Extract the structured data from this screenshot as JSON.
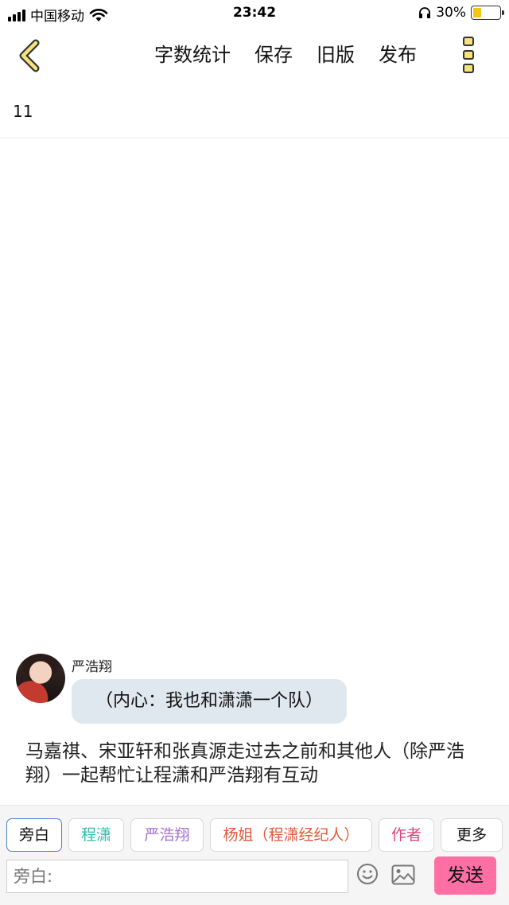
{
  "status_bar": {
    "carrier": "中国移动",
    "time": "23:42",
    "battery_percent": "30%",
    "battery_level": 0.3
  },
  "nav": {
    "actions": [
      "字数统计",
      "保存",
      "旧版",
      "发布"
    ],
    "back_icon": "chevron-left-icon",
    "more_icon": "more-vertical-icon",
    "accent_color": "#f7e27a"
  },
  "title": "11",
  "message": {
    "speaker": "严浩翔",
    "text": "（内心：我也和潇潇一个队）"
  },
  "narration": "马嘉祺、宋亚轩和张真源走过去之前和其他人（除严浩翔）一起帮忙让程潇和严浩翔有互动",
  "roles": [
    {
      "label": "旁白",
      "color": "#111111",
      "width": 70,
      "active": true
    },
    {
      "label": "程潇",
      "color": "#35b9b0",
      "width": 70,
      "active": false
    },
    {
      "label": "严浩翔",
      "color": "#a56fd6",
      "width": 92,
      "active": false
    },
    {
      "label": "杨姐（程潇经纪人）",
      "color": "#e05a3c",
      "width": 204,
      "active": false
    },
    {
      "label": "作者",
      "color": "#e0407a",
      "width": 70,
      "active": false
    },
    {
      "label": "更多",
      "color": "#111111",
      "width": 78,
      "active": false
    }
  ],
  "composer": {
    "placeholder": "旁白:",
    "send_label": "发送",
    "send_color": "#ff6fa3"
  }
}
